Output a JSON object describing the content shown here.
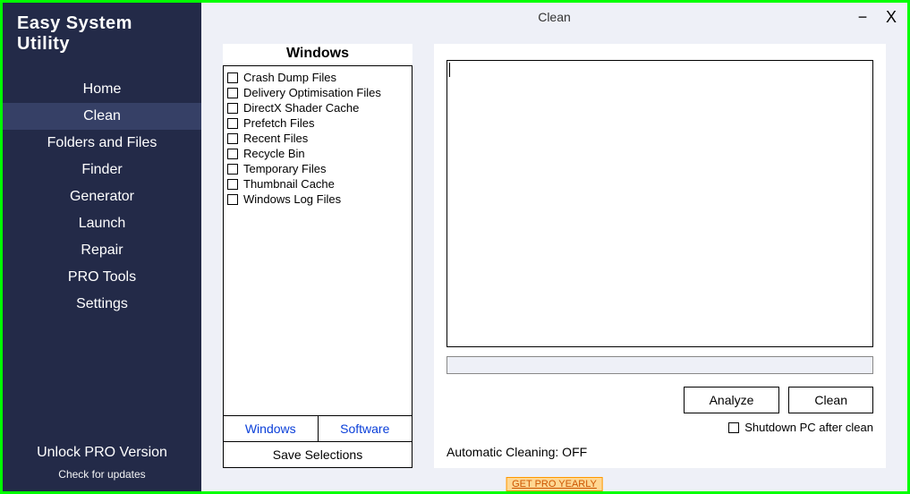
{
  "app_title": "Easy System Utility",
  "page_title": "Clean",
  "window": {
    "minimize": "−",
    "close": "X"
  },
  "sidebar": {
    "items": [
      {
        "label": "Home"
      },
      {
        "label": "Clean"
      },
      {
        "label": "Folders and Files"
      },
      {
        "label": "Finder"
      },
      {
        "label": "Generator"
      },
      {
        "label": "Launch"
      },
      {
        "label": "Repair"
      },
      {
        "label": "PRO Tools"
      },
      {
        "label": "Settings"
      }
    ],
    "active_index": 1,
    "unlock": "Unlock PRO Version",
    "updates": "Check for updates"
  },
  "left_panel": {
    "heading": "Windows",
    "items": [
      "Crash Dump Files",
      "Delivery Optimisation Files",
      "DirectX Shader Cache",
      "Prefetch Files",
      "Recent Files",
      "Recycle Bin",
      "Temporary Files",
      "Thumbnail Cache",
      "Windows Log Files"
    ],
    "tabs": {
      "windows": "Windows",
      "software": "Software"
    },
    "save": "Save Selections"
  },
  "right_panel": {
    "analyze": "Analyze",
    "clean": "Clean",
    "shutdown_label": "Shutdown PC after clean",
    "auto_label": "Automatic Cleaning: OFF"
  },
  "footer": {
    "pro_link": "GET PRO YEARLY"
  }
}
